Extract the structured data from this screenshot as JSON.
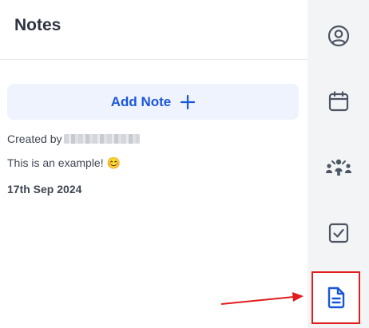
{
  "notes": {
    "title": "Notes",
    "add_note_label": "Add Note",
    "items": [
      {
        "created_by_label": "Created by",
        "body": "This is an example! 😊",
        "date": "17th Sep 2024"
      }
    ]
  },
  "rail": {
    "items": [
      {
        "icon": "user-circle-icon"
      },
      {
        "icon": "calendar-icon"
      },
      {
        "icon": "people-network-icon"
      },
      {
        "icon": "checkbox-icon"
      },
      {
        "icon": "document-icon",
        "active": true
      }
    ]
  },
  "colors": {
    "accent": "#1a56db",
    "button_bg": "#eef3fd",
    "rail_bg": "#f3f4f6",
    "highlight": "#e11d1d"
  }
}
